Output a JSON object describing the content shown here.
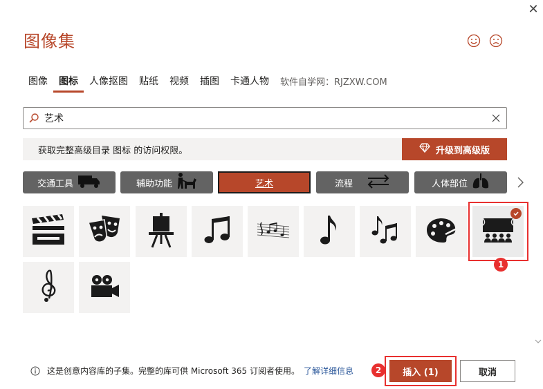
{
  "dialog": {
    "title": "图像集",
    "close_glyph": "✕"
  },
  "tabs": [
    {
      "label": "图像",
      "active": false
    },
    {
      "label": "图标",
      "active": true
    },
    {
      "label": "人像抠图",
      "active": false
    },
    {
      "label": "贴纸",
      "active": false
    },
    {
      "label": "视频",
      "active": false
    },
    {
      "label": "插图",
      "active": false
    },
    {
      "label": "卡通人物",
      "active": false
    }
  ],
  "watermark": "软件自学网：RJZXW.COM",
  "search": {
    "value": "艺术",
    "placeholder": ""
  },
  "upgrade": {
    "text": "获取完整高级目录 图标 的访问权限。",
    "button_label": "升级到高级版"
  },
  "categories": [
    {
      "label": "交通工具",
      "icon": "truck-icon",
      "active": false
    },
    {
      "label": "辅助功能",
      "icon": "guide-dog-icon",
      "active": false
    },
    {
      "label": "艺术",
      "icon": "",
      "active": true
    },
    {
      "label": "流程",
      "icon": "arrows-swap-icon",
      "active": false
    },
    {
      "label": "人体部位",
      "icon": "lungs-icon",
      "active": false
    }
  ],
  "icons": [
    {
      "name": "clapperboard-icon",
      "selected": false
    },
    {
      "name": "theater-masks-icon",
      "selected": false
    },
    {
      "name": "easel-icon",
      "selected": false
    },
    {
      "name": "music-notes-beamed-icon",
      "selected": false
    },
    {
      "name": "music-staff-icon",
      "selected": false
    },
    {
      "name": "eighth-note-icon",
      "selected": false
    },
    {
      "name": "music-notes-double-icon",
      "selected": false
    },
    {
      "name": "paint-palette-icon",
      "selected": false
    },
    {
      "name": "theater-audience-icon",
      "selected": true
    },
    {
      "name": "treble-clef-icon",
      "selected": false
    },
    {
      "name": "movie-camera-icon",
      "selected": false
    }
  ],
  "annotations": {
    "step1": "1",
    "step2": "2",
    "color": "#e8302f"
  },
  "footer": {
    "info_text": "这是创意内容库的子集。完整的库可供 Microsoft 365 订阅者使用。",
    "link_text": "了解详细信息",
    "insert_label": "插入 (1)",
    "cancel_label": "取消"
  },
  "colors": {
    "accent": "#b7472a",
    "category_bg": "#636363",
    "tile_bg": "#f3f2f1",
    "link": "#2b579a"
  }
}
